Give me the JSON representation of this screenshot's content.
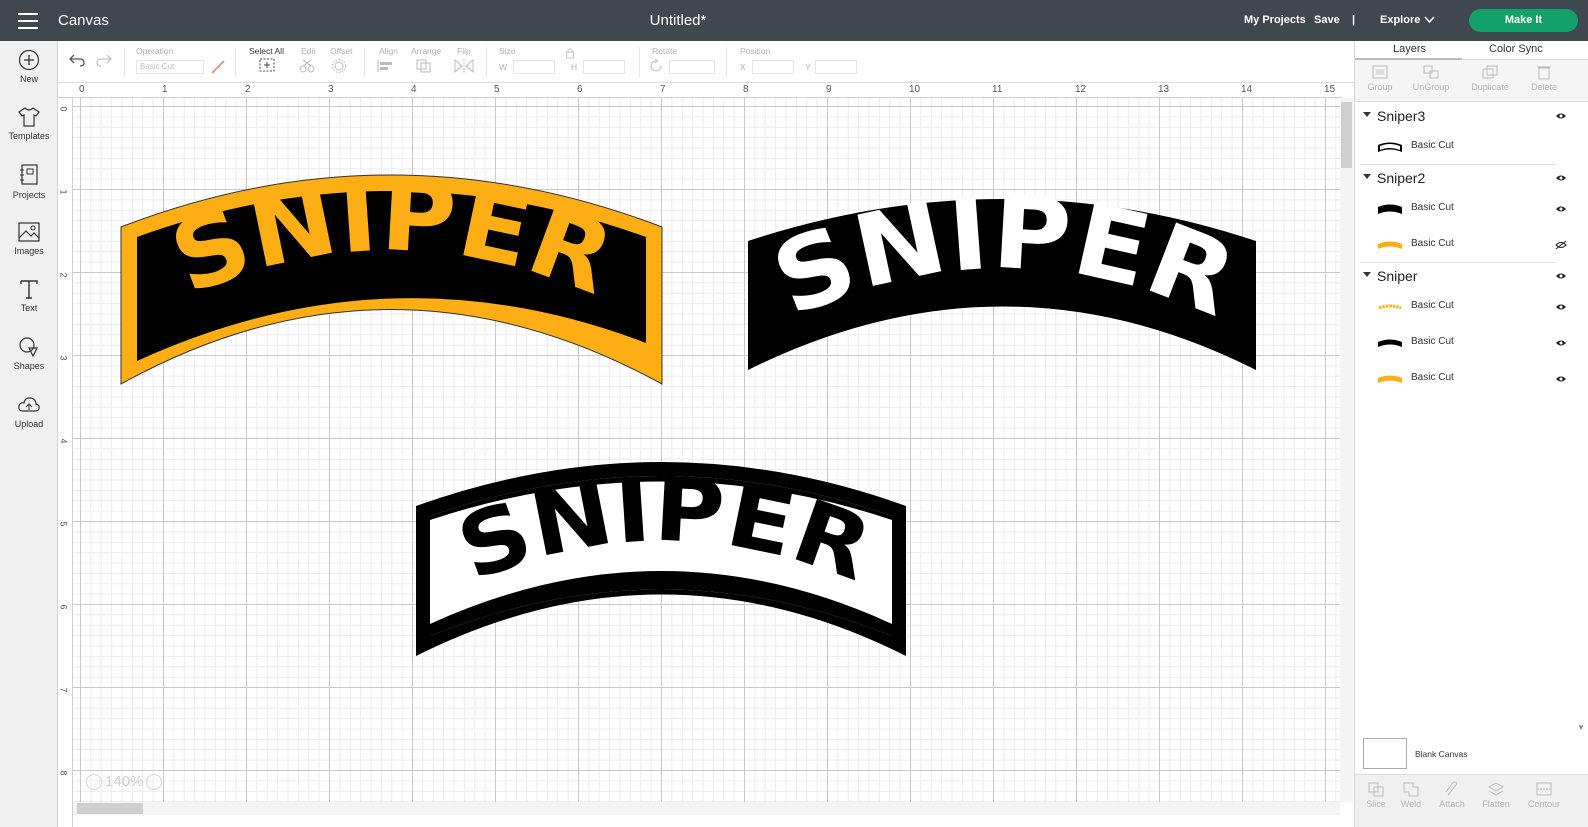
{
  "header": {
    "app_title": "Canvas",
    "doc_title": "Untitled*",
    "my_projects": "My Projects",
    "save": "Save",
    "separator": "|",
    "explore": "Explore",
    "make_it": "Make It"
  },
  "sidebar": {
    "items": [
      {
        "label": "New",
        "icon": "plus-circle-icon"
      },
      {
        "label": "Templates",
        "icon": "shirt-icon"
      },
      {
        "label": "Projects",
        "icon": "projects-icon"
      },
      {
        "label": "Images",
        "icon": "image-icon"
      },
      {
        "label": "Text",
        "icon": "text-icon"
      },
      {
        "label": "Shapes",
        "icon": "shapes-icon"
      },
      {
        "label": "Upload",
        "icon": "cloud-upload-icon"
      }
    ]
  },
  "toolbar": {
    "operation_label": "Operation",
    "operation_value": "Basic Cut",
    "select_all": "Select All",
    "edit": "Edit",
    "offset": "Offset",
    "align": "Align",
    "arrange": "Arrange",
    "flip": "Flip",
    "size": "Size",
    "w": "W",
    "h": "H",
    "rotate": "Rotate",
    "position": "Position",
    "x": "X",
    "y": "Y"
  },
  "ruler": {
    "top": [
      "0",
      "1",
      "2",
      "3",
      "4",
      "5",
      "6",
      "7",
      "8",
      "9",
      "10",
      "11",
      "12",
      "13",
      "14",
      "15"
    ],
    "left": [
      "0",
      "1",
      "2",
      "3",
      "4",
      "5",
      "6",
      "7",
      "8"
    ]
  },
  "canvas": {
    "zoom": "140%",
    "art_text": "SNIPER",
    "colors": {
      "gold": "#fdae14",
      "black": "#000000",
      "white": "#ffffff"
    }
  },
  "panel": {
    "tab_layers": "Layers",
    "tab_color_sync": "Color Sync",
    "actions": [
      "Group",
      "UnGroup",
      "Duplicate",
      "Delete"
    ],
    "groups": [
      {
        "name": "Sniper3",
        "rows": [
          {
            "label": "Basic Cut",
            "thumb": "outline-tab",
            "visible": true
          }
        ]
      },
      {
        "name": "Sniper2",
        "rows": [
          {
            "label": "Basic Cut",
            "thumb": "black-tab",
            "visible": true
          },
          {
            "label": "Basic Cut",
            "thumb": "gold-arc",
            "visible": false
          }
        ]
      },
      {
        "name": "Sniper",
        "rows": [
          {
            "label": "Basic Cut",
            "thumb": "gold-text",
            "visible": true
          },
          {
            "label": "Basic Cut",
            "thumb": "black-arc",
            "visible": true
          },
          {
            "label": "Basic Cut",
            "thumb": "gold-arc",
            "visible": true
          }
        ]
      }
    ],
    "blank_canvas": "Blank Canvas",
    "bottom_actions": [
      "Slice",
      "Weld",
      "Attach",
      "Flatten",
      "Contour"
    ]
  }
}
